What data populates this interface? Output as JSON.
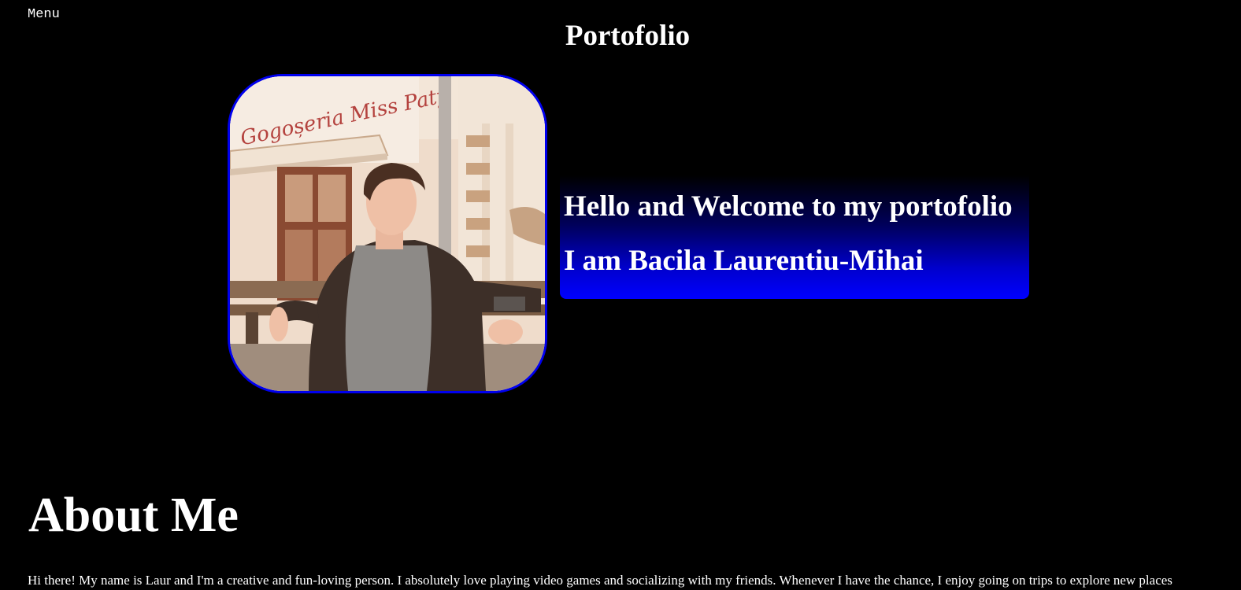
{
  "nav": {
    "menu_label": "Menu"
  },
  "header": {
    "title": "Portofolio"
  },
  "hero": {
    "welcome_line1": "Hello and Welcome to my portofolio",
    "welcome_line2": "I am Bacila Laurentiu-Mihai",
    "photo_sign_text": "Gogoșeria Miss Paty",
    "frame_color": "#0000ee",
    "box_gradient_end": "#0000ff"
  },
  "about": {
    "heading": "About Me",
    "text": "Hi there! My name is Laur and I'm a creative and fun-loving person. I absolutely love playing video games and socializing with my friends. Whenever I have the chance, I enjoy going on trips to explore new places"
  }
}
